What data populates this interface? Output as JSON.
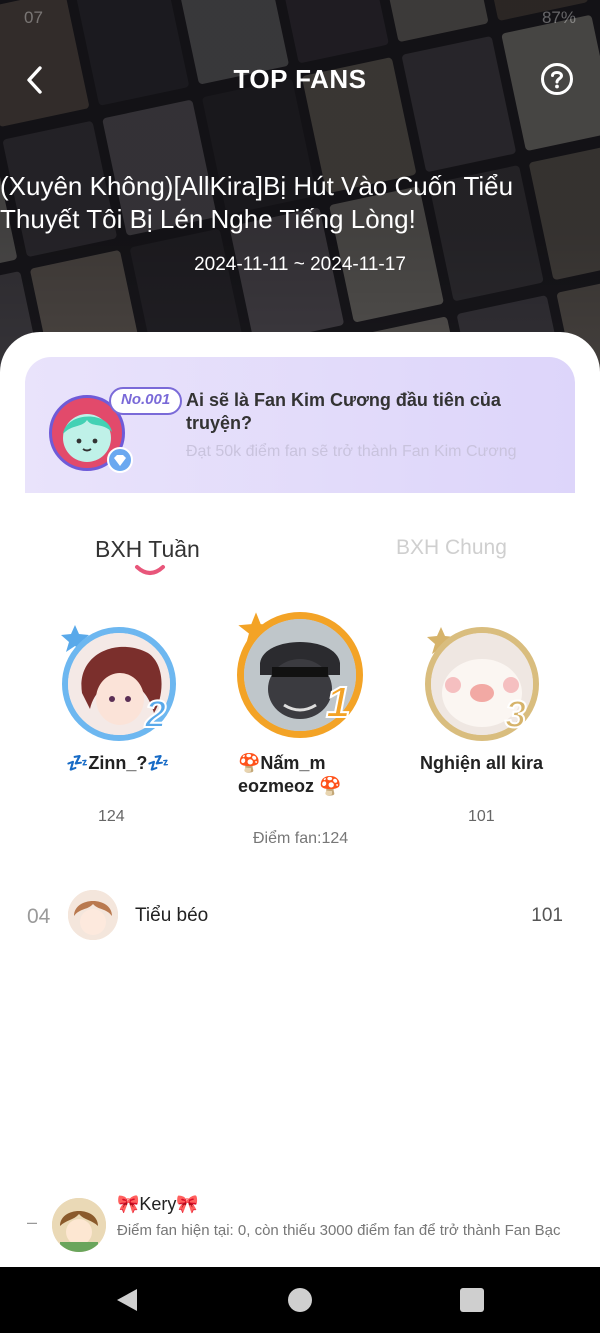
{
  "status": {
    "time": "07",
    "battery": "87%"
  },
  "header": {
    "title": "TOP FANS"
  },
  "story": {
    "title": "(Xuyên Không)[AllKira]Bị Hút Vào Cuốn Tiểu Thuyết Tôi Bị Lén Nghe Tiếng Lòng!",
    "dates": "2024-11-11 ~ 2024-11-17"
  },
  "promo": {
    "tag": "No.001",
    "question": "Ai sẽ là Fan Kim Cương đầu tiên của truyện?",
    "subtitle": "Đạt 50k điểm fan sẽ trở thành Fan Kim Cương"
  },
  "tabs": {
    "week": "BXH Tuần",
    "overall": "BXH Chung"
  },
  "podium": [
    {
      "rank": "2",
      "name": "💤Zinn_?💤",
      "score": "124"
    },
    {
      "rank": "1",
      "name": "🍄Nấm_m eozmeoz 🍄",
      "score_label": "Điểm fan:124"
    },
    {
      "rank": "3",
      "name": "Nghiện all kira",
      "score": "101"
    }
  ],
  "list": [
    {
      "no": "04",
      "name": "Tiểu béo",
      "score": "101"
    }
  ],
  "me": {
    "dash": "–",
    "name": "🎀Kery🎀",
    "info": "Điểm fan hiện tại: 0, còn thiếu 3000 điểm fan để trở thành Fan Bạc"
  },
  "colors": {
    "accent": "#e8567a",
    "gold": "#f3a326",
    "silver": "#59a9ea",
    "bronze": "#d6b36a",
    "promo": "#e3dcfb"
  }
}
